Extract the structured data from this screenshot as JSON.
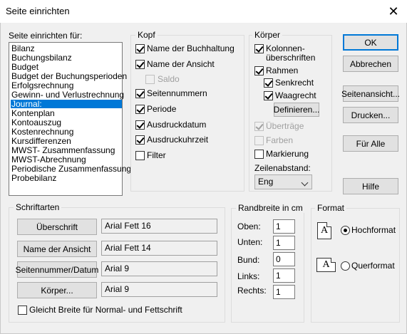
{
  "window": {
    "title": "Seite einrichten",
    "close_glyph": "✕"
  },
  "report_list": {
    "label": "Seite einrichten für:",
    "items": [
      "Bilanz",
      "Buchungsbilanz",
      "Budget",
      "Budget der Buchungsperioden",
      "Erfolgsrechnung",
      "Gewinn- und Verlustrechnung",
      "Journal:",
      "Kontenplan",
      "Kontoauszug",
      "Kostenrechnung",
      "Kursdifferenzen",
      "MWST- Zusammenfassung",
      "MWST-Abrechnung",
      "Periodische Zusammenfassung",
      "Probebilanz"
    ],
    "selected": "Journal:"
  },
  "kopf": {
    "legend": "Kopf",
    "items": [
      {
        "label": "Name der Buchhaltung",
        "checked": true,
        "enabled": true
      },
      {
        "label": "Name der Ansicht",
        "checked": true,
        "enabled": true
      },
      {
        "label": "Saldo",
        "checked": false,
        "enabled": false
      },
      {
        "label": "Seitennummern",
        "checked": true,
        "enabled": true
      },
      {
        "label": "Periode",
        "checked": true,
        "enabled": true
      },
      {
        "label": "Ausdruckdatum",
        "checked": true,
        "enabled": true
      },
      {
        "label": "Ausdruckuhrzeit",
        "checked": true,
        "enabled": true
      },
      {
        "label": "Filter",
        "checked": false,
        "enabled": true
      }
    ]
  },
  "koerper": {
    "legend": "Körper",
    "kolonnen_line1": "Kolonnen-",
    "kolonnen_line2": "überschriften",
    "kolonnen_checked": true,
    "rahmen": {
      "label": "Rahmen",
      "checked": true
    },
    "senkrecht": {
      "label": "Senkrecht",
      "checked": true
    },
    "waagrecht": {
      "label": "Waagrecht",
      "checked": true
    },
    "definieren_button": "Definieren...",
    "uebertraege": {
      "label": "Überträge",
      "checked": true,
      "enabled": false
    },
    "farben": {
      "label": "Farben",
      "checked": false,
      "enabled": false
    },
    "markierung": {
      "label": "Markierung",
      "checked": false
    },
    "zeilenabstand_label": "Zeilenabstand:",
    "zeilenabstand_value": "Eng"
  },
  "buttons": {
    "ok": "OK",
    "abbrechen": "Abbrechen",
    "seitenansicht": "Seitenansicht...",
    "drucken": "Drucken...",
    "fuer_alle": "Für Alle",
    "hilfe": "Hilfe"
  },
  "schriftarten": {
    "legend": "Schriftarten",
    "rows": [
      {
        "button": "Überschrift",
        "font": "Arial Fett 16"
      },
      {
        "button": "Name der Ansicht",
        "font": "Arial Fett 14"
      },
      {
        "button": "Seitennummer/Datum",
        "font": "Arial 9"
      },
      {
        "button": "Körper...",
        "font": "Arial 9"
      }
    ],
    "gleiche_breite": {
      "label": "Gleicht Breite für Normal- und Fettschrift",
      "checked": false
    }
  },
  "randbreite": {
    "legend": "Randbreite in cm",
    "fields": [
      {
        "label": "Oben:",
        "value": "1"
      },
      {
        "label": "Unten:",
        "value": "1"
      },
      {
        "label": "Bund:",
        "value": "0"
      },
      {
        "label": "Links:",
        "value": "1"
      },
      {
        "label": "Rechts:",
        "value": "1"
      }
    ]
  },
  "format": {
    "legend": "Format",
    "icon_letter": "A",
    "hochformat": {
      "label": "Hochformat",
      "selected": true
    },
    "querformat": {
      "label": "Querformat",
      "selected": false
    }
  }
}
